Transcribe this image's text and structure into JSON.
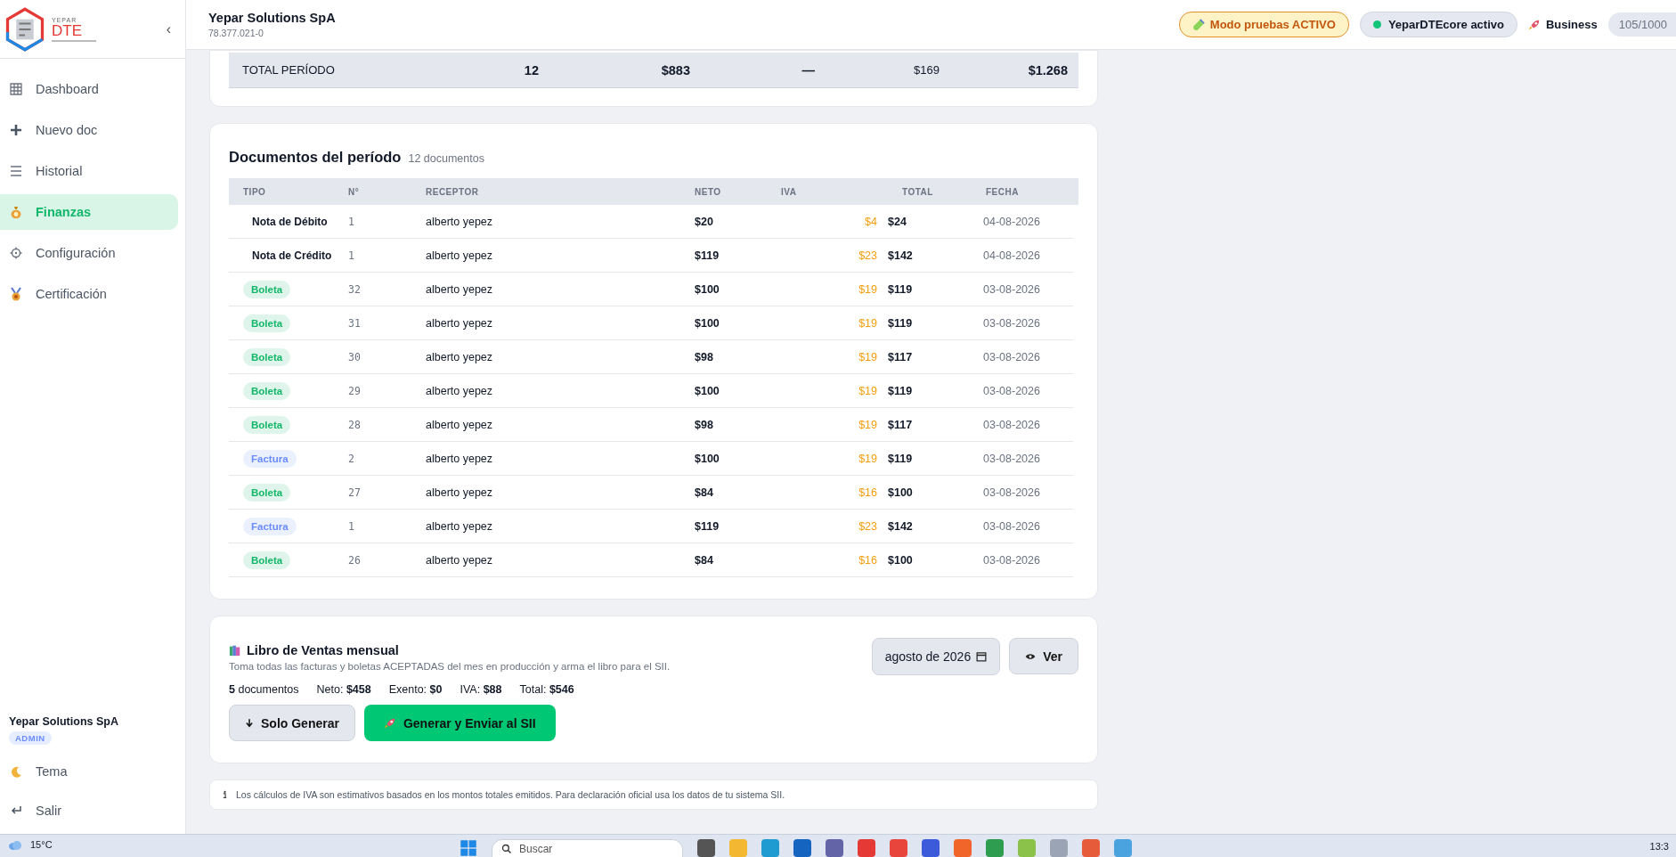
{
  "sidebar": {
    "logo": {
      "brand": "YEPAR",
      "product": "DTE"
    },
    "collapse": "‹",
    "items": [
      {
        "label": "Dashboard",
        "selected": false
      },
      {
        "label": "Nuevo doc",
        "selected": false
      },
      {
        "label": "Historial",
        "selected": false
      },
      {
        "label": "Finanzas",
        "selected": true
      },
      {
        "label": "Configuración",
        "selected": false
      },
      {
        "label": "Certificación",
        "selected": false
      }
    ],
    "account": {
      "name": "Yepar Solutions SpA",
      "role": "ADMIN"
    },
    "footer_items": [
      {
        "label": "Tema"
      },
      {
        "label": "Salir"
      }
    ]
  },
  "header": {
    "company": "Yepar Solutions SpA",
    "rut": "78.377.021-0",
    "test_mode": "Modo pruebas ACTIVO",
    "core_status": {
      "label": "YeparDTEcore activo",
      "color": "#10c47a"
    },
    "plan": "Business",
    "usage": "105/1000"
  },
  "totals_row": {
    "label": "TOTAL PERÍODO",
    "cells": [
      "12",
      "$883",
      "—",
      "$169",
      "$1.268"
    ]
  },
  "documents": {
    "title": "Documentos del período",
    "count": "12 documentos",
    "columns": [
      "TIPO",
      "N°",
      "RECEPTOR",
      "NETO",
      "IVA",
      "TOTAL",
      "FECHA"
    ],
    "rows": [
      {
        "tipo": "Nota de Débito",
        "kind": "text",
        "numero": "1",
        "receptor": "alberto yepez",
        "neto": "$20",
        "iva": "$4",
        "total": "$24",
        "fecha": "04-08-2026"
      },
      {
        "tipo": "Nota de Crédito",
        "kind": "text",
        "numero": "1",
        "receptor": "alberto yepez",
        "neto": "$119",
        "iva": "$23",
        "total": "$142",
        "fecha": "04-08-2026"
      },
      {
        "tipo": "Boleta",
        "kind": "badge",
        "color": "#12b76a",
        "numero": "32",
        "receptor": "alberto yepez",
        "neto": "$100",
        "iva": "$19",
        "total": "$119",
        "fecha": "03-08-2026"
      },
      {
        "tipo": "Boleta",
        "kind": "badge",
        "color": "#12b76a",
        "numero": "31",
        "receptor": "alberto yepez",
        "neto": "$100",
        "iva": "$19",
        "total": "$119",
        "fecha": "03-08-2026"
      },
      {
        "tipo": "Boleta",
        "kind": "badge",
        "color": "#12b76a",
        "numero": "30",
        "receptor": "alberto yepez",
        "neto": "$98",
        "iva": "$19",
        "total": "$117",
        "fecha": "03-08-2026"
      },
      {
        "tipo": "Boleta",
        "kind": "badge",
        "color": "#12b76a",
        "numero": "29",
        "receptor": "alberto yepez",
        "neto": "$100",
        "iva": "$19",
        "total": "$119",
        "fecha": "03-08-2026"
      },
      {
        "tipo": "Boleta",
        "kind": "badge",
        "color": "#12b76a",
        "numero": "28",
        "receptor": "alberto yepez",
        "neto": "$98",
        "iva": "$19",
        "total": "$117",
        "fecha": "03-08-2026"
      },
      {
        "tipo": "Factura",
        "kind": "badge",
        "color": "#6b8cff",
        "numero": "2",
        "receptor": "alberto yepez",
        "neto": "$100",
        "iva": "$19",
        "total": "$119",
        "fecha": "03-08-2026"
      },
      {
        "tipo": "Boleta",
        "kind": "badge",
        "color": "#12b76a",
        "numero": "27",
        "receptor": "alberto yepez",
        "neto": "$84",
        "iva": "$16",
        "total": "$100",
        "fecha": "03-08-2026"
      },
      {
        "tipo": "Factura",
        "kind": "badge",
        "color": "#6b8cff",
        "numero": "1",
        "receptor": "alberto yepez",
        "neto": "$119",
        "iva": "$23",
        "total": "$142",
        "fecha": "03-08-2026"
      },
      {
        "tipo": "Boleta",
        "kind": "badge",
        "color": "#12b76a",
        "numero": "26",
        "receptor": "alberto yepez",
        "neto": "$84",
        "iva": "$16",
        "total": "$100",
        "fecha": "03-08-2026"
      }
    ]
  },
  "libro": {
    "title": "Libro de Ventas mensual",
    "description": "Toma todas las facturas y boletas ACEPTADAS del mes en producción y arma el libro para el SII.",
    "summary": [
      "**5** documentos",
      "Neto: **$458**",
      "Exento: **$0**",
      "IVA: **$88**",
      "Total: **$546**"
    ],
    "month": "agosto de 2026",
    "view_button": "Ver",
    "buttons": [
      {
        "label": "Solo Generar",
        "kind": "secondary"
      },
      {
        "label": "Generar y Enviar al SII",
        "kind": "primary"
      }
    ]
  },
  "note": "Los cálculos de IVA son estimativos basados en los montos totales emitidos. Para declaración oficial usa los datos de tu sistema SII.",
  "taskbar": {
    "weather": "15°C",
    "search_placeholder": "Buscar",
    "clock": "13:3"
  }
}
